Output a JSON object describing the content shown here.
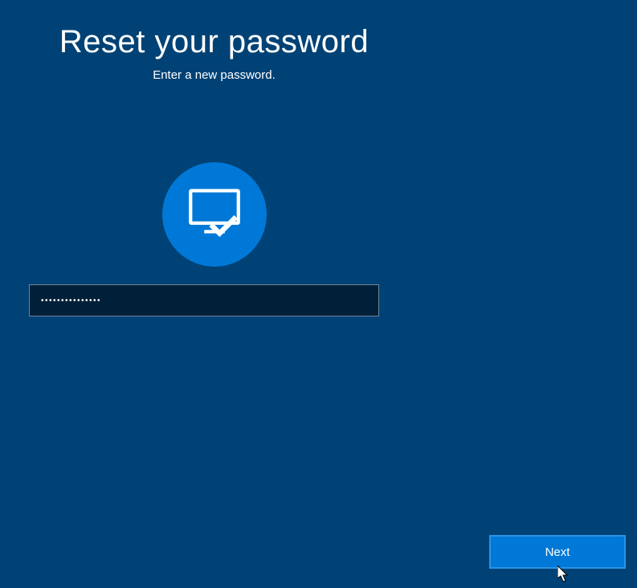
{
  "header": {
    "title": "Reset your password",
    "subtitle": "Enter a new password."
  },
  "form": {
    "password_mask": "•••••••••••••••"
  },
  "actions": {
    "next_label": "Next"
  }
}
